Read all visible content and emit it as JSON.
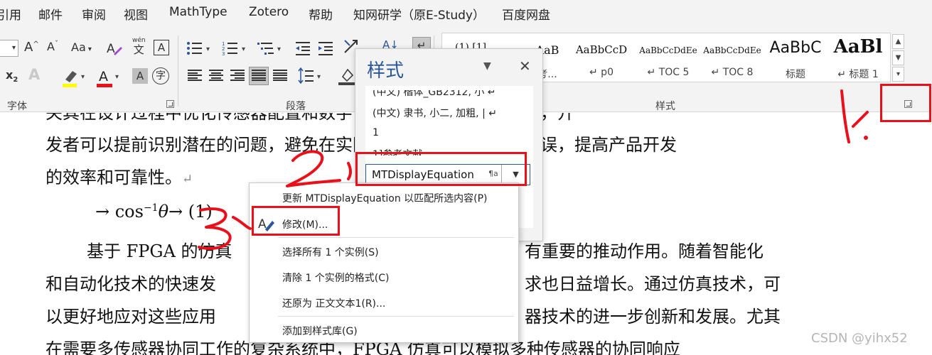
{
  "menubar": {
    "items": [
      "引用",
      "邮件",
      "审阅",
      "视图",
      "MathType",
      "Zotero",
      "帮助",
      "知网研学（原E-Study）",
      "百度网盘"
    ]
  },
  "ribbon": {
    "font_group_label": "字体",
    "paragraph_group_label": "段落",
    "styles_group_label": "样式",
    "font_size_grow": "A^",
    "font_size_shrink": "Aˇ",
    "change_case": "Aa",
    "phonetic_top": "wén",
    "phonetic_bottom": "文",
    "border_char": "A",
    "subscript": "x₂",
    "text_effect": "A",
    "highlight": "ab",
    "font_color": "A",
    "char_shading": "A",
    "enclose_char": "字",
    "styles_gallery": [
      {
        "sample": "AaB",
        "name": "考..."
      },
      {
        "sample": "AaBbCcD",
        "name": "↵ p0"
      },
      {
        "sample": "AaBbCcDdEe",
        "name": "↵ TOC 5"
      },
      {
        "sample": "AaBbCcDdEe",
        "name": "↵ TOC 8"
      },
      {
        "sample": "AaBbC",
        "name": "标题"
      },
      {
        "sample": "AaBl",
        "name": "↵ 标题 1"
      }
    ],
    "gallery_hidden_top": "(1)  [1]"
  },
  "document": {
    "line1": "关其在设计过程中优化传感器配置和数字设计。通过这种仿真技术，开",
    "line2": "发者可以提前识别潜在的问题，避免在实际开发过程中出现重大错误，提高产品开发",
    "line3": "的效率和可靠性。",
    "equation": "→  cos",
    "equation_sup": "−1",
    "equation_theta": "θ",
    "equation_tail": "→ (1)",
    "line4_a": "基于 FPGA 的仿真",
    "line4_b": "有重要的推动作用。随着智能化",
    "line5_a": "和自动化技术的快速发",
    "line5_b": "求也日益增长。通过仿真技术，可",
    "line6_a": "以更好地应对这些应用",
    "line6_b": "器技术的进一步创新和发展。尤其",
    "line7": "在需要多传感器协同工作的复杂系统中，FPGA 仿真可以模拟多种传感器的协同响应",
    "para_mark": "↵"
  },
  "styles_pane": {
    "title": "样式",
    "list": [
      "(中文) 楷体_GB2312, 小 ↵",
      "(中文) 隶书, 小二, 加粗, | ↵",
      "1",
      "1]参考文献"
    ],
    "selected_style": "MTDisplayEquation",
    "selected_mark": "¶a",
    "dropdown_icon": "▼",
    "close_icon": "✕",
    "options_icon": "▼"
  },
  "context_menu": {
    "items": [
      "更新 MTDisplayEquation 以匹配所选内容(P)",
      "修改(M)...",
      "选择所有 1 个实例(S)",
      "清除 1 个实例的格式(C)",
      "还原为 正文文本1(R)...",
      "添加到样式库(G)"
    ]
  },
  "annotations": {
    "color": "#e8101a",
    "step1": "1.",
    "step2": "2.",
    "step3": "3"
  },
  "watermark": "CSDN @yihx52",
  "colors": {
    "accent": "#2b579a",
    "highlight": "#ffff00",
    "font_color": "#e8101a"
  }
}
